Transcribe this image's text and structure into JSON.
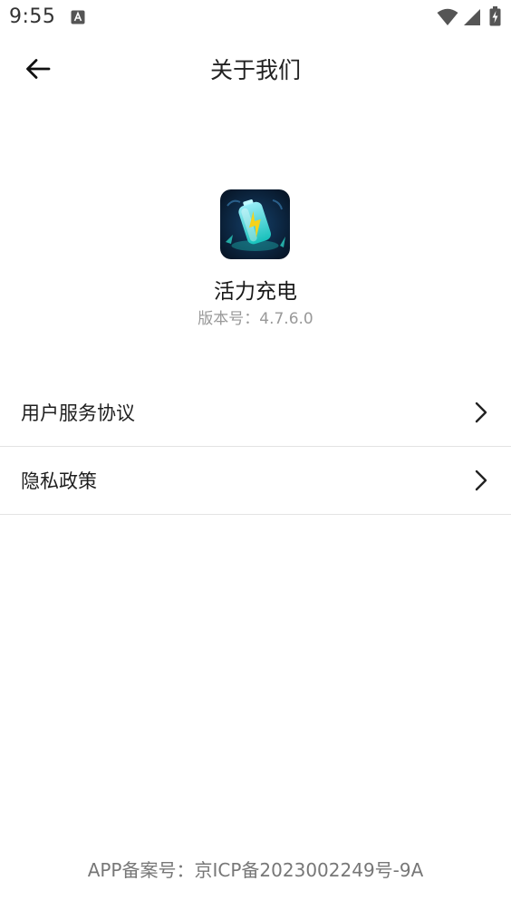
{
  "status_bar": {
    "time": "9:55",
    "icons": [
      "text-a-icon",
      "wifi-icon",
      "signal-icon",
      "battery-icon"
    ]
  },
  "header": {
    "title": "关于我们",
    "back_icon": "arrow-left-icon"
  },
  "app": {
    "name": "活力充电",
    "version_label": "版本号：",
    "version": "4.7.6.0",
    "icon": "battery-charging-app-icon"
  },
  "menu": {
    "items": [
      {
        "label": "用户服务协议"
      },
      {
        "label": "隐私政策"
      }
    ]
  },
  "footer": {
    "record_label": "APP备案号：",
    "record_number": "京ICP备2023002249号-9A"
  },
  "colors": {
    "background": "#ffffff",
    "text_primary": "#222222",
    "text_secondary": "#999999",
    "divider": "#e3e3e3",
    "app_icon_bg": "#0b1e35",
    "app_icon_accent": "#2fe6d3",
    "bolt": "#f5d21a"
  }
}
